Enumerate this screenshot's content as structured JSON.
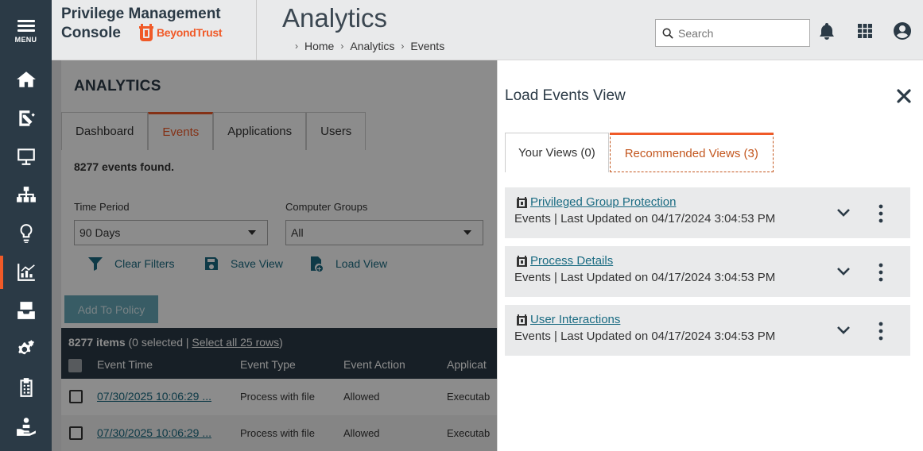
{
  "sidebar": {
    "menu_label": "MENU",
    "items": [
      {
        "name": "home",
        "icon": "home-icon"
      },
      {
        "name": "policies",
        "icon": "policy-edit-icon"
      },
      {
        "name": "computers",
        "icon": "monitor-icon"
      },
      {
        "name": "groups",
        "icon": "hierarchy-icon"
      },
      {
        "name": "ideas",
        "icon": "lightbulb-icon"
      },
      {
        "name": "analytics",
        "icon": "analytics-chart-icon",
        "active": true
      },
      {
        "name": "inbox",
        "icon": "inbox-icon"
      },
      {
        "name": "settings",
        "icon": "gears-icon"
      },
      {
        "name": "tasks",
        "icon": "clipboard-icon"
      },
      {
        "name": "support",
        "icon": "hand-user-icon"
      }
    ]
  },
  "header": {
    "brand_line1": "Privilege Management",
    "brand_line2": "Console",
    "brand_logo_text": "BeyondTrust",
    "page_title": "Analytics",
    "breadcrumb": [
      "Home",
      "Analytics",
      "Events"
    ],
    "search_placeholder": "Search"
  },
  "main": {
    "heading": "ANALYTICS",
    "tabs": [
      {
        "label": "Dashboard",
        "active": false
      },
      {
        "label": "Events",
        "active": true
      },
      {
        "label": "Applications",
        "active": false
      },
      {
        "label": "Users",
        "active": false
      }
    ],
    "found_text": "8277 events found.",
    "filters": {
      "time_period_label": "Time Period",
      "time_period_value": "90 Days",
      "computer_groups_label": "Computer Groups",
      "computer_groups_value": "All"
    },
    "actions": {
      "clear_filters": "Clear Filters",
      "save_view": "Save View",
      "load_view": "Load View",
      "add_to_policy": "Add To Policy"
    },
    "grid": {
      "count_bold": "8277 items",
      "count_selected": " (0 selected | ",
      "select_all": "Select all 25 rows",
      "count_close": ")",
      "columns": [
        "Event Time",
        "Event Type",
        "Event Action",
        "Applicat"
      ],
      "rows": [
        {
          "time": "07/30/2025 10:06:29 ...",
          "type": "Process with file",
          "action": "Allowed",
          "app": "Executab"
        },
        {
          "time": "07/30/2025 10:06:29 ...",
          "type": "Process with file",
          "action": "Allowed",
          "app": "Executab"
        }
      ]
    }
  },
  "panel": {
    "title": "Load Events View",
    "tabs": [
      {
        "label": "Your Views (0)",
        "active": false
      },
      {
        "label": "Recommended Views (3)",
        "active": true
      }
    ],
    "views": [
      {
        "name": "Privileged Group Protection",
        "subtitle": "Events | Last Updated on 04/17/2024 3:04:53 PM"
      },
      {
        "name": "Process Details",
        "subtitle": "Events | Last Updated on 04/17/2024 3:04:53 PM"
      },
      {
        "name": "User Interactions",
        "subtitle": "Events | Last Updated on 04/17/2024 3:04:53 PM"
      }
    ]
  },
  "colors": {
    "sidebar_bg": "#2b3a46",
    "accent_orange": "#f05a28",
    "link_teal": "#1a6b82",
    "card_bg": "#e9eaeb"
  }
}
